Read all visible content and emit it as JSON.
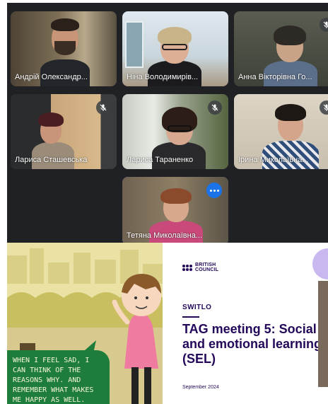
{
  "participants": [
    {
      "name": "Андрій Олександр...",
      "muted": false
    },
    {
      "name": "Ніна Володимирів...",
      "muted": false
    },
    {
      "name": "Анна Вікторівна Го...",
      "muted": true
    },
    {
      "name": "Лариса Сташевська",
      "muted": true
    },
    {
      "name": "Лариса Тараненко",
      "muted": true
    },
    {
      "name": "Ірина Миколаївна...",
      "muted": true
    },
    {
      "name": "Тетяна Миколаївна...",
      "muted": false,
      "speaking": true
    }
  ],
  "slide": {
    "bubble_text": "When I feel sad, I can think of the reasons why. And remember what makes me happy as well.",
    "logo_line1": "BRITISH",
    "logo_line2": "COUNCIL",
    "program": "SWITLO",
    "title": "TAG meeting 5: Social and emotional learning (SEL)",
    "date": "September 2024"
  },
  "colors": {
    "meet_bg": "#202124",
    "speaking_outline": "#8ab4f8",
    "more_button": "#1a73e8",
    "slide_text": "#23085a",
    "bubble_green": "#1e7d3a"
  },
  "icons": {
    "muted": "mic-off-icon",
    "more": "more-options-icon"
  }
}
